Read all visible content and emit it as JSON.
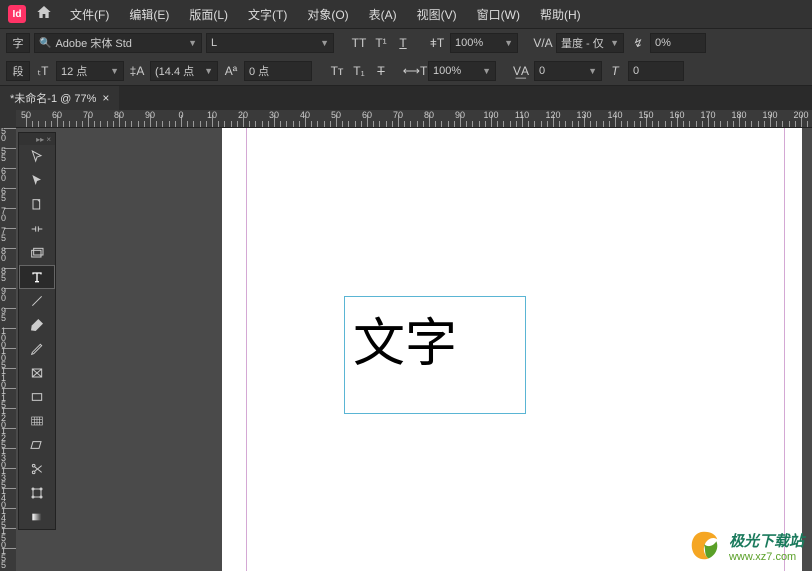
{
  "app": {
    "icon_letter": "Id"
  },
  "menu": {
    "file": "文件(F)",
    "edit": "编辑(E)",
    "layout": "版面(L)",
    "text": "文字(T)",
    "object": "对象(O)",
    "table": "表(A)",
    "view": "视图(V)",
    "window": "窗口(W)",
    "help": "帮助(H)"
  },
  "controls": {
    "char_tab": "字",
    "para_tab": "段",
    "font_family": "Adobe 宋体 Std",
    "font_style": "L",
    "font_size": "12 点",
    "leading": "(14.4 点",
    "tracking": "0",
    "baseline": "0 点",
    "vscale": "100%",
    "hscale": "100%",
    "kerning": "量度 - 仅",
    "tracking2": "0",
    "skew": "0",
    "opacity": "0%"
  },
  "doctab": {
    "label": "*未命名-1 @ 77%"
  },
  "ruler_h": [
    "50",
    "60",
    "70",
    "80",
    "90",
    "0",
    "10",
    "20",
    "30",
    "40",
    "50",
    "60",
    "70",
    "80",
    "90",
    "100",
    "110",
    "120",
    "130",
    "140",
    "150",
    "160",
    "170",
    "180",
    "190",
    "200"
  ],
  "ruler_v": [
    "5",
    "0",
    "5",
    "0",
    "6",
    "0",
    "6",
    "5",
    "7",
    "0",
    "7",
    "5",
    "8",
    "0",
    "8",
    "5",
    "9",
    "0",
    "9",
    "5",
    "1",
    "0",
    "0",
    "1",
    "0",
    "5",
    "1",
    "1",
    "0",
    "1",
    "1",
    "5",
    "1",
    "2",
    "0",
    "1",
    "2",
    "5",
    "1",
    "3",
    "0",
    "1",
    "3",
    "5",
    "1",
    "4",
    "0",
    "1",
    "4",
    "5",
    "1",
    "5",
    "0",
    "1",
    "5",
    "5"
  ],
  "canvas": {
    "text_content": "文字"
  },
  "watermark": {
    "title": "极光下载站",
    "url": "www.xz7.com"
  }
}
